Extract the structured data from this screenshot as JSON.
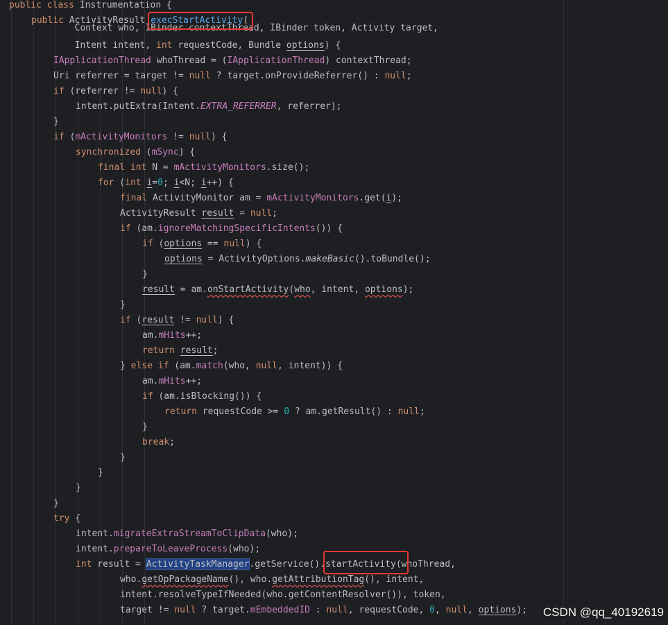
{
  "editor": {
    "lines": [
      [
        "public",
        " ",
        "class",
        " Instrumentation {"
      ],
      [
        "public",
        " ActivityResult ",
        "execStartActivity",
        "("
      ],
      [
        "        Context who, IBinder contextThread, IBinder token, Activity target,"
      ],
      [
        "        Intent intent, ",
        "int",
        " requestCode, Bundle ",
        "options",
        ") {"
      ],
      [
        "IApplicationThread",
        " whoThread = (",
        "IApplicationThread",
        ") contextThread;"
      ],
      [
        "Uri referrer = target != ",
        "null",
        " ? target.onProvideReferrer() : ",
        "null",
        ";"
      ],
      [
        "if",
        " (referrer != ",
        "null",
        ") {"
      ],
      [
        "intent.putExtra(Intent.",
        "EXTRA_REFERRER",
        ", referrer);"
      ],
      [
        "}"
      ],
      [
        "if",
        " (",
        "mActivityMonitors",
        " != ",
        "null",
        ") {"
      ],
      [
        "synchronized",
        " (",
        "mSync",
        ") {"
      ],
      [
        "final",
        " ",
        "int",
        " N = ",
        "mActivityMonitors",
        ".size();"
      ],
      [
        "for",
        " (",
        "int",
        " ",
        "i",
        "=",
        "0",
        "; ",
        "i",
        "<N; ",
        "i",
        "++) {"
      ],
      [
        "final",
        " ActivityMonitor am = ",
        "mActivityMonitors",
        ".get(",
        "i",
        ");"
      ],
      [
        "ActivityResult ",
        "result",
        " = ",
        "null",
        ";"
      ],
      [
        "if",
        " (am.",
        "ignoreMatchingSpecificIntents",
        "()) {"
      ],
      [
        "if",
        " (",
        "options",
        " == ",
        "null",
        ") {"
      ],
      [
        "options",
        " = ActivityOptions.",
        "makeBasic",
        "().toBundle();"
      ],
      [
        "}"
      ],
      [
        "result",
        " = am.",
        "onStartActivity",
        "(",
        "who",
        ", intent, ",
        "options",
        ");"
      ],
      [
        "}"
      ],
      [
        "if",
        " (",
        "result",
        " != ",
        "null",
        ") {"
      ],
      [
        "am.",
        "mHits",
        "++;"
      ],
      [
        "return",
        " ",
        "result",
        ";"
      ],
      [
        "} ",
        "else",
        " ",
        "if",
        " (am.",
        "match",
        "(who, ",
        "null",
        ", intent)) {"
      ],
      [
        "am.",
        "mHits",
        "++;"
      ],
      [
        "if",
        " (am.isBlocking()) {"
      ],
      [
        "return",
        " requestCode >= ",
        "0",
        " ? am.getResult() : ",
        "null",
        ";"
      ],
      [
        "}"
      ],
      [
        "break",
        ";"
      ],
      [
        "}"
      ],
      [
        "}"
      ],
      [
        "}"
      ],
      [
        "}"
      ],
      [
        "try",
        " {"
      ],
      [
        "intent.",
        "migrateExtraStreamToClipData",
        "(who);"
      ],
      [
        "intent.",
        "prepareToLeaveProcess",
        "(who);"
      ],
      [
        "int",
        " result = ",
        "ActivityTaskManager",
        ".getService()",
        ".startActivity",
        "(whoThread,"
      ],
      [
        "who.",
        "getOpPackageName",
        "(), who.",
        "getAttributionTag",
        "(), intent,"
      ],
      [
        "intent.resolveTypeIfNeeded(who.getContentResolver()), token,"
      ],
      [
        "target != ",
        "null",
        " ? target.",
        "mEmbeddedID",
        " : ",
        "null",
        ", requestCode, ",
        "0",
        ", ",
        "null",
        ", ",
        "options",
        ");"
      ]
    ]
  },
  "watermark": "CSDN @qq_40192619",
  "colors": {
    "background": "#1e1f22",
    "keyword": "#cf8e6d",
    "field": "#c77dbb",
    "method": "#56a8f5",
    "number": "#2aacb8",
    "highlight_box": "#e53935"
  }
}
